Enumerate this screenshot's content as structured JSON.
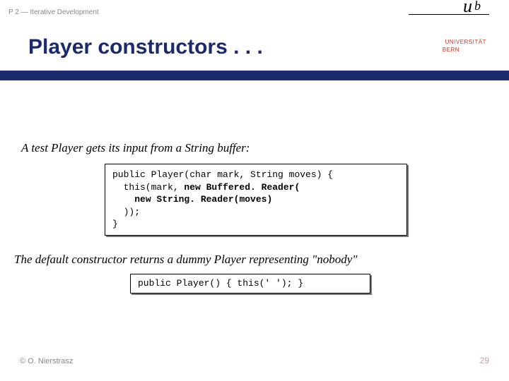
{
  "header": {
    "left": "P 2 — Iterative Development"
  },
  "logo": {
    "u": "u",
    "b": "b",
    "uni": "UNIVERSITÄT",
    "bern": "BERN"
  },
  "title": "Player constructors . . .",
  "intro1": "A test Player gets its input from a String buffer:",
  "code1": {
    "l1a": "public Player(char mark, String moves) {",
    "l2a": "  this(mark, ",
    "l2b": "new Buffered. Reader(",
    "l3a": "    ",
    "l3b": "new String. Reader(moves)",
    "l4a": "  ));",
    "l5a": "}"
  },
  "intro2": "The default constructor returns a dummy Player representing \"nobody\"",
  "code2": "public Player() { this(' '); }",
  "footer": {
    "left": "© O. Nierstrasz",
    "right": "29"
  }
}
